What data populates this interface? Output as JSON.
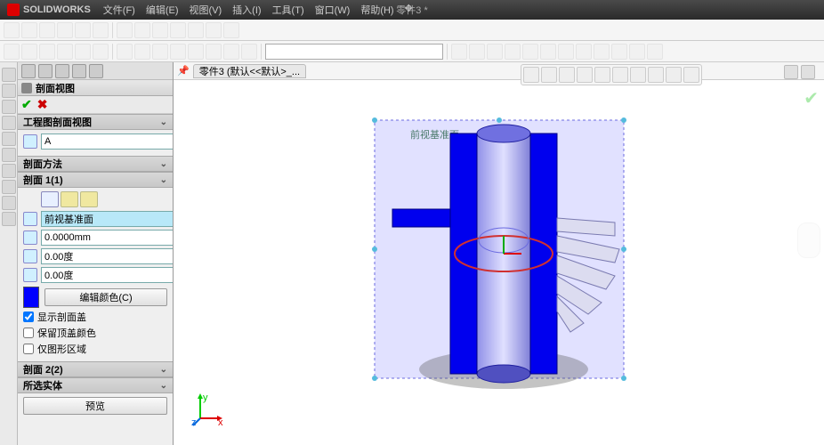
{
  "app": {
    "brand": "SOLIDWORKS",
    "document": "零件3 *"
  },
  "menu": [
    "文件(F)",
    "编辑(E)",
    "视图(V)",
    "插入(I)",
    "工具(T)",
    "窗口(W)",
    "帮助(H)"
  ],
  "viewport": {
    "tab": "零件3  (默认<<默认>_...",
    "plane_label": "前视基准面"
  },
  "prop": {
    "title": "剖面视图",
    "sec_drawing": {
      "header": "工程图剖面视图",
      "label": "A",
      "value": "A"
    },
    "sec_method": {
      "header": "剖面方法"
    },
    "sec1": {
      "header": "剖面 1(1)",
      "plane": "前视基准面",
      "offset": "0.0000mm",
      "angle1": "0.00度",
      "angle2": "0.00度",
      "edit_color": "编辑颜色(C)",
      "cb_show_cap": "显示剖面盖",
      "cb_keep_cap_color": "保留顶盖颜色",
      "cb_graphics_only": "仅图形区域",
      "cb_show_cap_checked": true,
      "cb_keep_cap_checked": false,
      "cb_graphics_checked": false
    },
    "sec2": {
      "header": "剖面 2(2)"
    },
    "sec_selected": {
      "header": "所选实体"
    },
    "preview": "预览"
  }
}
